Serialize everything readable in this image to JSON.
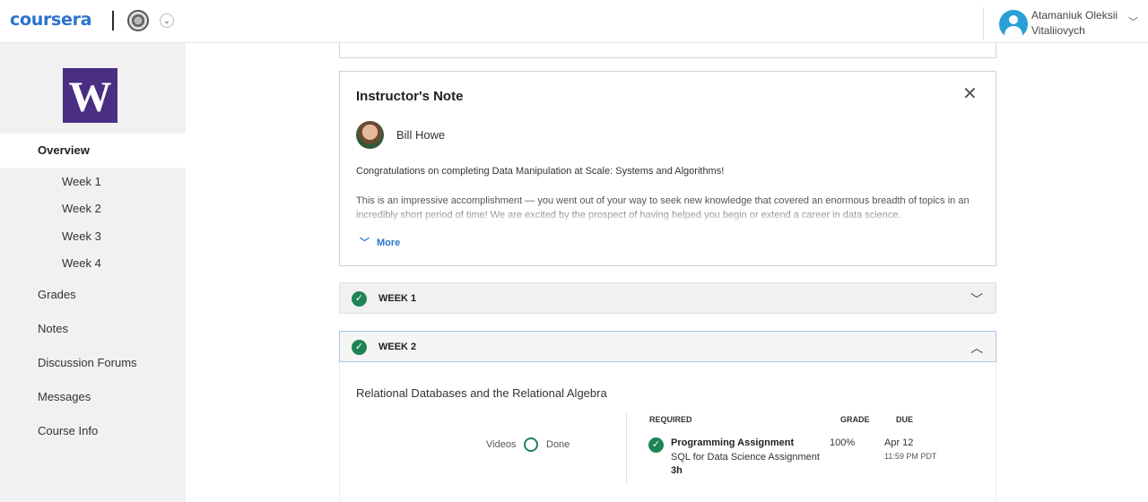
{
  "header": {
    "logo_text": "coursera",
    "user_name_line1": "Atamaniuk Oleksii",
    "user_name_line2": "Vitaliiovych"
  },
  "sidebar": {
    "logo_letter": "W",
    "overview": "Overview",
    "weeks": [
      "Week 1",
      "Week 2",
      "Week 3",
      "Week 4"
    ],
    "items": [
      "Grades",
      "Notes",
      "Discussion Forums",
      "Messages",
      "Course Info"
    ]
  },
  "instructor_note": {
    "title": "Instructor's Note",
    "instructor_name": "Bill Howe",
    "paragraph1": "Congratulations on completing Data Manipulation at Scale: Systems and Algorithms!",
    "paragraph2": "This is an impressive accomplishment — you went out of your way to seek new knowledge that covered an enormous breadth of topics in an incredibly short period of time! We are excited by the prospect of having helped you begin or extend a career in data science.",
    "more_label": "More"
  },
  "weeks": {
    "week1_label": "WEEK 1",
    "week2_label": "WEEK 2"
  },
  "week2": {
    "module_title": "Relational Databases and the Relational Algebra",
    "videos_label": "Videos",
    "done_label": "Done",
    "col_required": "REQUIRED",
    "col_grade": "GRADE",
    "col_due": "DUE",
    "item_title": "Programming Assignment",
    "item_subtitle": "SQL for Data Science Assignment",
    "item_duration": "3h",
    "item_grade": "100%",
    "item_due_date": "Apr 12",
    "item_due_time": "11:59 PM PDT"
  },
  "colors": {
    "brand_blue": "#2a73cc",
    "uw_purple": "#4b2e83",
    "success_green": "#1f8354"
  }
}
